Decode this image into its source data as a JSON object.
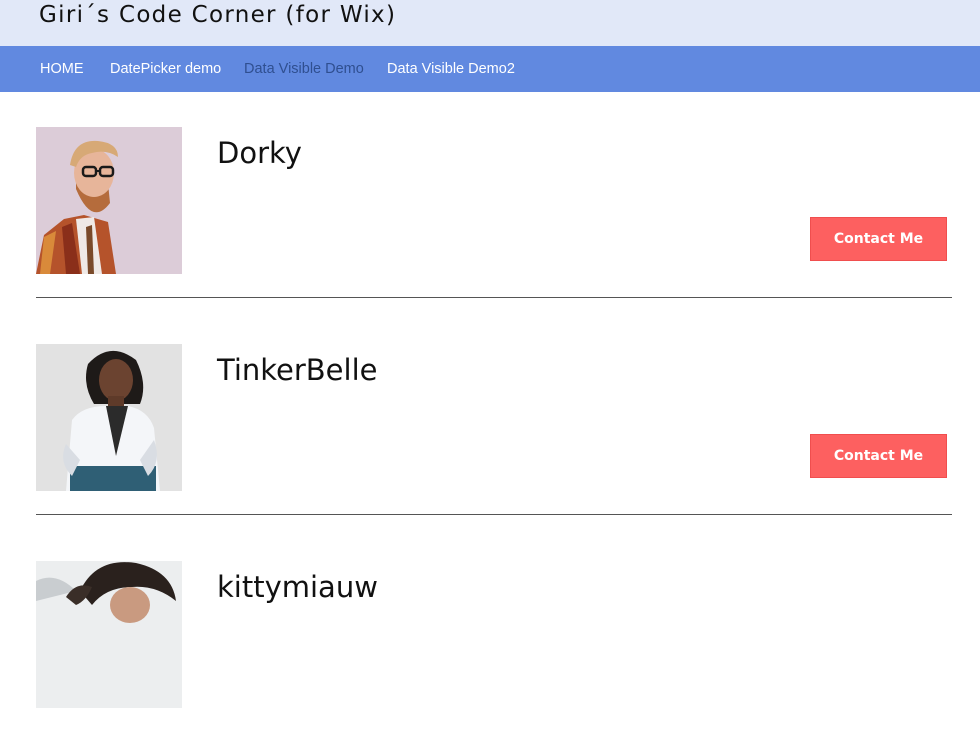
{
  "header": {
    "site_title": "Giri´s Code Corner (for Wix)"
  },
  "nav": {
    "items": [
      {
        "label": "HOME",
        "active": false
      },
      {
        "label": "DatePicker demo",
        "active": false
      },
      {
        "label": "Data Visible Demo",
        "active": true
      },
      {
        "label": "Data Visible Demo2",
        "active": false
      }
    ]
  },
  "profiles": [
    {
      "name": "Dorky",
      "button_label": "Contact Me",
      "photo": "man-with-beard-and-glasses"
    },
    {
      "name": "TinkerBelle",
      "button_label": "Contact Me",
      "photo": "woman-in-white-shirt"
    },
    {
      "name": "kittymiauw",
      "photo": "woman-with-dark-curly-hair"
    }
  ],
  "colors": {
    "header_bg": "#e1e8f8",
    "nav_bg": "#6189e0",
    "nav_text": "#ffffff",
    "nav_active_text": "#2f4f90",
    "button_bg": "#fd6060",
    "divider": "#555555"
  }
}
